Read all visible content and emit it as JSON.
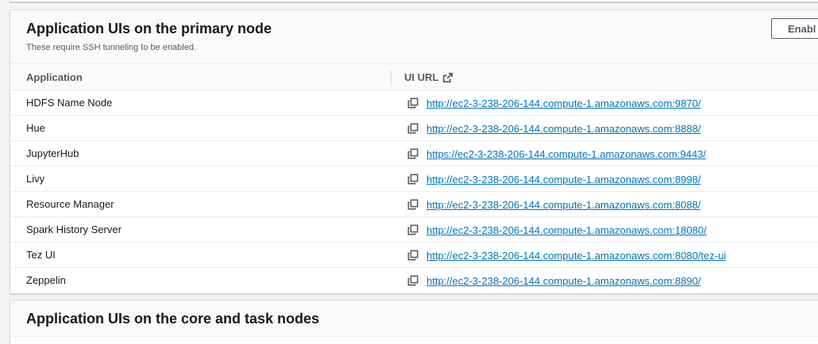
{
  "primary_panel": {
    "title": "Application UIs on the primary node",
    "subtitle": "These require SSH tunneling to be enabled.",
    "enable_button": "Enabl",
    "columns": {
      "application": "Application",
      "ui_url": "UI URL"
    },
    "rows": [
      {
        "application": "HDFS Name Node",
        "url": "http://ec2-3-238-206-144.compute-1.amazonaws.com:9870/"
      },
      {
        "application": "Hue",
        "url": "http://ec2-3-238-206-144.compute-1.amazonaws.com:8888/"
      },
      {
        "application": "JupyterHub",
        "url": "https://ec2-3-238-206-144.compute-1.amazonaws.com:9443/"
      },
      {
        "application": "Livy",
        "url": "http://ec2-3-238-206-144.compute-1.amazonaws.com:8998/"
      },
      {
        "application": "Resource Manager",
        "url": "http://ec2-3-238-206-144.compute-1.amazonaws.com:8088/"
      },
      {
        "application": "Spark History Server",
        "url": "http://ec2-3-238-206-144.compute-1.amazonaws.com:18080/"
      },
      {
        "application": "Tez UI",
        "url": "http://ec2-3-238-206-144.compute-1.amazonaws.com:8080/tez-ui"
      },
      {
        "application": "Zeppelin",
        "url": "http://ec2-3-238-206-144.compute-1.amazonaws.com:8890/"
      }
    ]
  },
  "core_panel": {
    "title": "Application UIs on the core and task nodes"
  },
  "icons": {
    "copy": "copy-icon",
    "external_link": "external-link-icon"
  },
  "colors": {
    "link": "#0073bb",
    "text": "#16191f",
    "muted": "#545b64",
    "border": "#eaeded"
  }
}
